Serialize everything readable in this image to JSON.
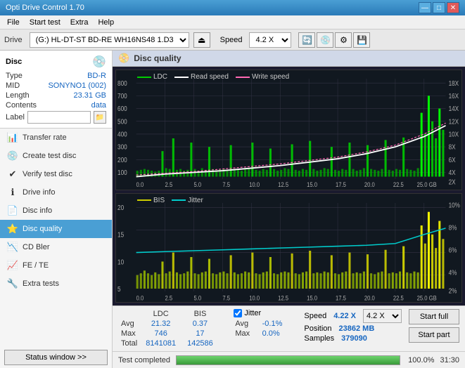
{
  "app": {
    "title": "Opti Drive Control 1.70",
    "titlebar_controls": [
      "—",
      "□",
      "✕"
    ]
  },
  "menubar": {
    "items": [
      "File",
      "Start test",
      "Extra",
      "Help"
    ]
  },
  "drivebar": {
    "label": "Drive",
    "drive_value": "(G:)  HL-DT-ST BD-RE  WH16NS48 1.D3",
    "speed_label": "Speed",
    "speed_value": "4.2 X"
  },
  "disc": {
    "header": "Disc",
    "type_label": "Type",
    "type_value": "BD-R",
    "mid_label": "MID",
    "mid_value": "SONYNO1 (002)",
    "length_label": "Length",
    "length_value": "23.31 GB",
    "contents_label": "Contents",
    "contents_value": "data",
    "label_label": "Label",
    "label_value": ""
  },
  "sidebar_nav": {
    "items": [
      {
        "id": "transfer-rate",
        "label": "Transfer rate",
        "icon": "📊"
      },
      {
        "id": "create-test-disc",
        "label": "Create test disc",
        "icon": "💿"
      },
      {
        "id": "verify-test-disc",
        "label": "Verify test disc",
        "icon": "✔"
      },
      {
        "id": "drive-info",
        "label": "Drive info",
        "icon": "ℹ"
      },
      {
        "id": "disc-info",
        "label": "Disc info",
        "icon": "📄"
      },
      {
        "id": "disc-quality",
        "label": "Disc quality",
        "icon": "⭐",
        "active": true
      },
      {
        "id": "cd-bler",
        "label": "CD Bler",
        "icon": "📉"
      },
      {
        "id": "fe-te",
        "label": "FE / TE",
        "icon": "📈"
      },
      {
        "id": "extra-tests",
        "label": "Extra tests",
        "icon": "🔧"
      }
    ],
    "status_btn": "Status window >>"
  },
  "disc_quality": {
    "title": "Disc quality",
    "legend": [
      {
        "label": "LDC",
        "color": "#00cc00"
      },
      {
        "label": "Read speed",
        "color": "#ffffff"
      },
      {
        "label": "Write speed",
        "color": "#ff69b4"
      }
    ],
    "legend2": [
      {
        "label": "BIS",
        "color": "#cccc00"
      },
      {
        "label": "Jitter",
        "color": "#00cccc"
      }
    ],
    "chart1": {
      "y_max": 800,
      "y_labels": [
        "800",
        "700",
        "600",
        "500",
        "400",
        "300",
        "200",
        "100"
      ],
      "y_right": [
        "18X",
        "16X",
        "14X",
        "12X",
        "10X",
        "8X",
        "6X",
        "4X",
        "2X"
      ],
      "x_labels": [
        "0.0",
        "2.5",
        "5.0",
        "7.5",
        "10.0",
        "12.5",
        "15.0",
        "17.5",
        "20.0",
        "22.5",
        "25.0 GB"
      ]
    },
    "chart2": {
      "y_max": 20,
      "y_labels": [
        "20",
        "15",
        "10",
        "5"
      ],
      "y_right": [
        "10%",
        "8%",
        "6%",
        "4%",
        "2%"
      ],
      "x_labels": [
        "0.0",
        "2.5",
        "5.0",
        "7.5",
        "10.0",
        "12.5",
        "15.0",
        "17.5",
        "20.0",
        "22.5",
        "25.0 GB"
      ]
    }
  },
  "stats": {
    "headers": [
      "",
      "LDC",
      "BIS",
      "",
      "Jitter",
      "Speed",
      ""
    ],
    "avg_label": "Avg",
    "avg_ldc": "21.32",
    "avg_bis": "0.37",
    "avg_jitter": "-0.1%",
    "max_label": "Max",
    "max_ldc": "746",
    "max_bis": "17",
    "max_jitter": "0.0%",
    "total_label": "Total",
    "total_ldc": "8141081",
    "total_bis": "142586",
    "speed_label": "Speed",
    "speed_value": "4.22 X",
    "speed_select": "4.2 X",
    "position_label": "Position",
    "position_value": "23862 MB",
    "samples_label": "Samples",
    "samples_value": "379090",
    "jitter_checked": true,
    "start_full_label": "Start full",
    "start_part_label": "Start part"
  },
  "progress": {
    "label": "Test completed",
    "value": 100,
    "pct_text": "100.0%",
    "time": "31:30"
  }
}
